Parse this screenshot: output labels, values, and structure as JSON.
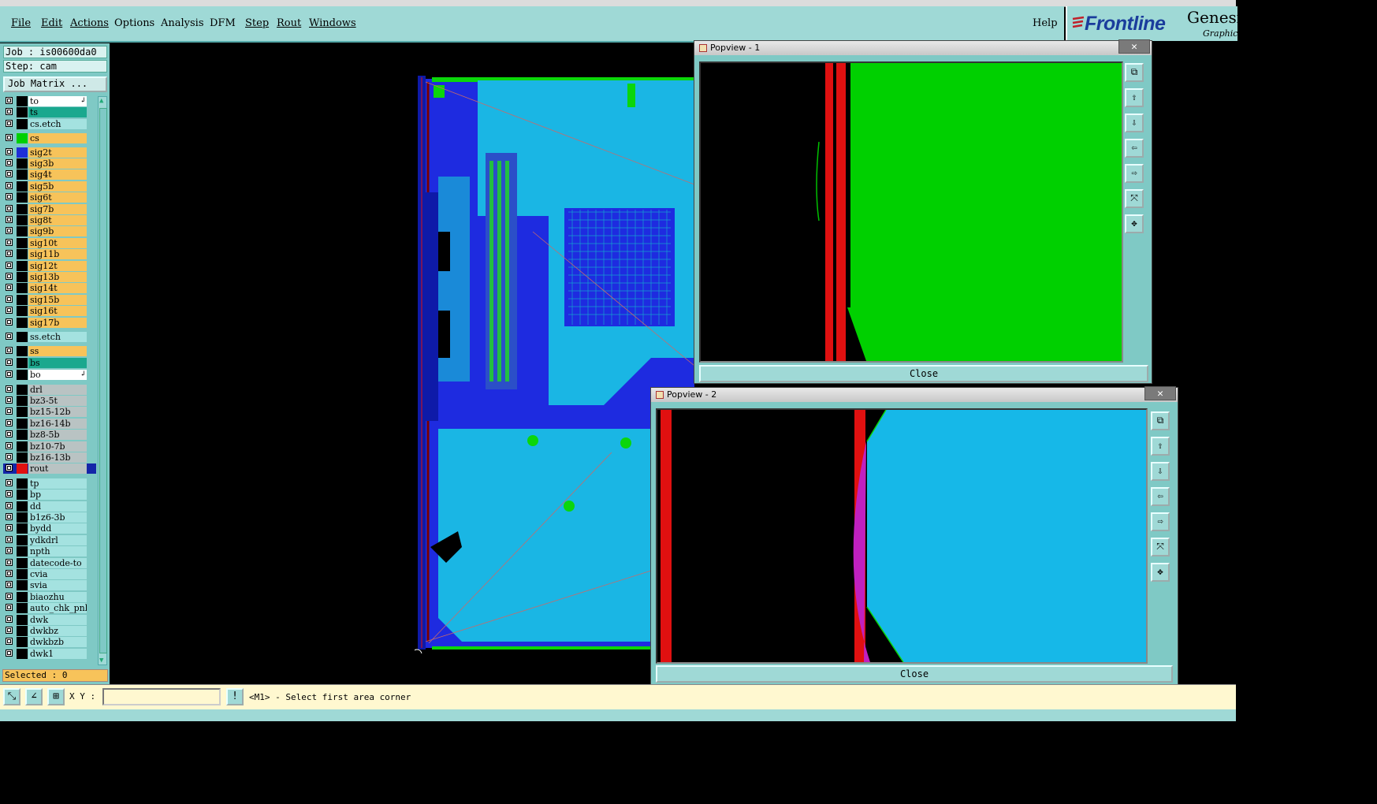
{
  "menu": {
    "items": [
      "File",
      "Edit",
      "Actions",
      "Options",
      "Analysis",
      "DFM",
      "Step",
      "Rout",
      "Windows"
    ],
    "help": "Help"
  },
  "logo": {
    "brand": "Frontline",
    "product": "Genesi",
    "sub": "Graphic"
  },
  "job": {
    "job_line": "Job : is00600da0",
    "step_line": "Step: cam",
    "matrix_button": "Job Matrix ..."
  },
  "colors": {
    "orange": "#f7c35a",
    "teal": "#1aa88e",
    "cyan": "#a4e2e0",
    "grey": "#b9c3c3",
    "white": "#ffffff",
    "green": "#00d000",
    "blue": "#1f2fd8",
    "red": "#e01010",
    "dark": "#123b8a"
  },
  "layers": [
    {
      "name": "to",
      "bg": "white",
      "swatch": "",
      "arrow": true
    },
    {
      "name": "ts",
      "bg": "teal",
      "swatch": ""
    },
    {
      "name": "cs.etch",
      "bg": "cyan",
      "swatch": ""
    },
    {
      "name": "cs",
      "bg": "orange",
      "swatch": "green"
    },
    {
      "name": "sig2t",
      "bg": "orange",
      "swatch": "blue"
    },
    {
      "name": "sig3b",
      "bg": "orange",
      "swatch": ""
    },
    {
      "name": "sig4t",
      "bg": "orange",
      "swatch": ""
    },
    {
      "name": "sig5b",
      "bg": "orange",
      "swatch": ""
    },
    {
      "name": "sig6t",
      "bg": "orange",
      "swatch": ""
    },
    {
      "name": "sig7b",
      "bg": "orange",
      "swatch": ""
    },
    {
      "name": "sig8t",
      "bg": "orange",
      "swatch": ""
    },
    {
      "name": "sig9b",
      "bg": "orange",
      "swatch": ""
    },
    {
      "name": "sig10t",
      "bg": "orange",
      "swatch": ""
    },
    {
      "name": "sig11b",
      "bg": "orange",
      "swatch": ""
    },
    {
      "name": "sig12t",
      "bg": "orange",
      "swatch": ""
    },
    {
      "name": "sig13b",
      "bg": "orange",
      "swatch": ""
    },
    {
      "name": "sig14t",
      "bg": "orange",
      "swatch": ""
    },
    {
      "name": "sig15b",
      "bg": "orange",
      "swatch": ""
    },
    {
      "name": "sig16t",
      "bg": "orange",
      "swatch": ""
    },
    {
      "name": "sig17b",
      "bg": "orange",
      "swatch": ""
    },
    {
      "name": "ss.etch",
      "bg": "cyan",
      "swatch": ""
    },
    {
      "name": "ss",
      "bg": "orange",
      "swatch": ""
    },
    {
      "name": "bs",
      "bg": "teal",
      "swatch": ""
    },
    {
      "name": "bo",
      "bg": "white",
      "swatch": "",
      "arrow": true
    },
    {
      "name": "drl",
      "bg": "grey",
      "swatch": ""
    },
    {
      "name": "bz3-5t",
      "bg": "grey",
      "swatch": ""
    },
    {
      "name": "bz15-12b",
      "bg": "grey",
      "swatch": ""
    },
    {
      "name": "bz16-14b",
      "bg": "grey",
      "swatch": ""
    },
    {
      "name": "bz8-5b",
      "bg": "grey",
      "swatch": ""
    },
    {
      "name": "bz10-7b",
      "bg": "grey",
      "swatch": ""
    },
    {
      "name": "bz16-13b",
      "bg": "grey",
      "swatch": ""
    },
    {
      "name": "rout",
      "bg": "grey",
      "swatch": "red",
      "dark": true
    },
    {
      "name": "tp",
      "bg": "cyan",
      "swatch": ""
    },
    {
      "name": "bp",
      "bg": "cyan",
      "swatch": ""
    },
    {
      "name": "dd",
      "bg": "cyan",
      "swatch": ""
    },
    {
      "name": "b1z6-3b",
      "bg": "cyan",
      "swatch": ""
    },
    {
      "name": "bydd",
      "bg": "cyan",
      "swatch": ""
    },
    {
      "name": "ydkdrl",
      "bg": "cyan",
      "swatch": ""
    },
    {
      "name": "npth",
      "bg": "cyan",
      "swatch": ""
    },
    {
      "name": "datecode-to",
      "bg": "cyan",
      "swatch": ""
    },
    {
      "name": "cvia",
      "bg": "cyan",
      "swatch": ""
    },
    {
      "name": "svia",
      "bg": "cyan",
      "swatch": ""
    },
    {
      "name": "biaozhu",
      "bg": "cyan",
      "swatch": ""
    },
    {
      "name": "auto_chk_pnl",
      "bg": "cyan",
      "swatch": ""
    },
    {
      "name": "dwk",
      "bg": "cyan",
      "swatch": ""
    },
    {
      "name": "dwkbz",
      "bg": "cyan",
      "swatch": ""
    },
    {
      "name": "dwkbzb",
      "bg": "cyan",
      "swatch": ""
    },
    {
      "name": "dwk1",
      "bg": "cyan",
      "swatch": ""
    }
  ],
  "selected": "Selected : 0",
  "status": {
    "xy_label": "X Y :",
    "xy_value": "",
    "prompt": "<M1> - Select first area corner"
  },
  "popview1": {
    "title": "Popview - 1",
    "close_label": "Close"
  },
  "popview2": {
    "title": "Popview - 2",
    "close_label": "Close"
  },
  "icons": {
    "toolbar": [
      "zoom-area-icon",
      "measure-icon",
      "grid-icon",
      "alert-icon"
    ],
    "popview": [
      "dock-icon",
      "pan-up-icon",
      "pan-down-icon",
      "pan-left-icon",
      "pan-right-icon",
      "zoom-fit-icon",
      "zoom-home-icon"
    ]
  }
}
